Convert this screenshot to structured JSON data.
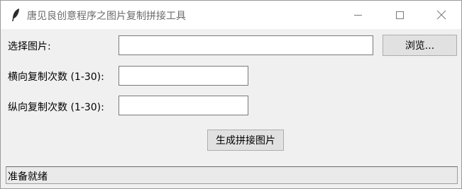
{
  "window": {
    "title": "唐见良创意程序之图片复制拼接工具",
    "app_icon": "feather-icon",
    "controls": [
      "minimize-icon",
      "maximize-icon",
      "close-icon"
    ]
  },
  "form": {
    "file_label": "选择图片:",
    "file_value": "",
    "browse_label": "浏览...",
    "horizontal_label": "横向复制次数 (1-30):",
    "horizontal_value": "",
    "vertical_label": "纵向复制次数 (1-30):",
    "vertical_value": ""
  },
  "actions": {
    "generate_label": "生成拼接图片"
  },
  "status": {
    "text": "准备就绪"
  }
}
